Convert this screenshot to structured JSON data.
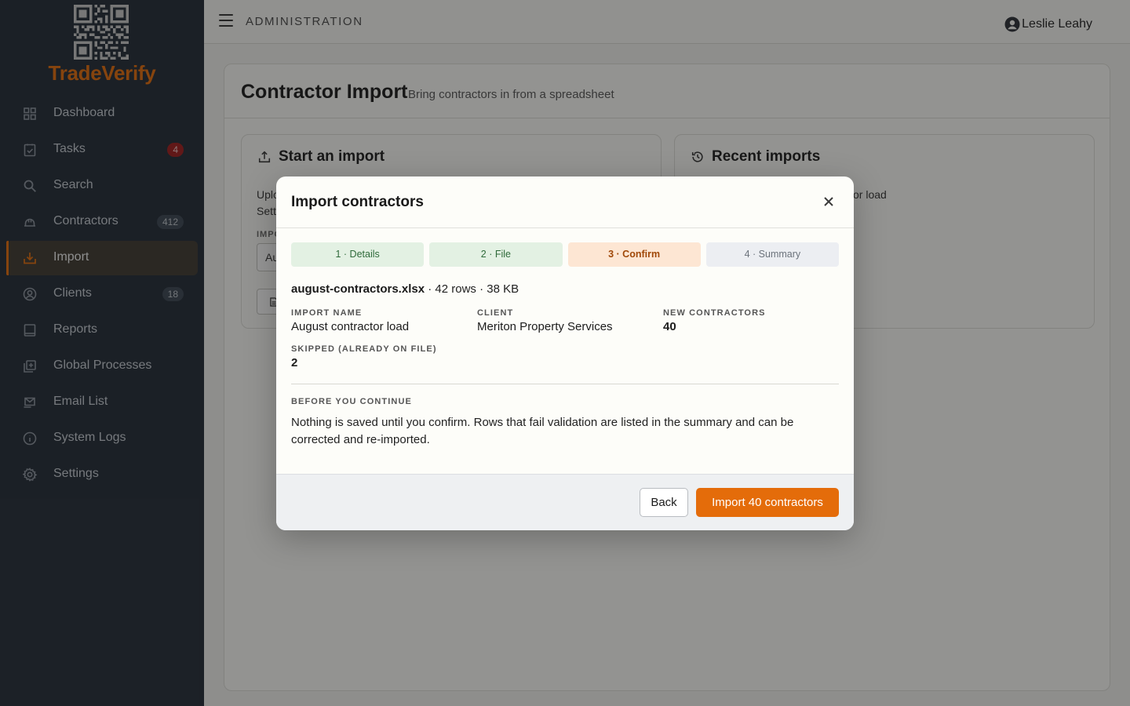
{
  "brand": {
    "name": "TradeVerify",
    "accent": "#e46c0a"
  },
  "topbar": {
    "section": "ADMINISTRATION",
    "user_name": "Leslie Leahy"
  },
  "sidebar": {
    "items": [
      {
        "label": "Dashboard",
        "icon": "grid-icon"
      },
      {
        "label": "Tasks",
        "icon": "clipboard-check-icon",
        "badge": "4"
      },
      {
        "label": "Search",
        "icon": "search-icon"
      },
      {
        "label": "Contractors",
        "icon": "hard-hat-icon",
        "badge": "412"
      },
      {
        "label": "Import",
        "icon": "download-tray-icon",
        "active": true
      },
      {
        "label": "Clients",
        "icon": "user-circle-icon",
        "badge": "18"
      },
      {
        "label": "Reports",
        "icon": "book-icon"
      },
      {
        "label": "Global Processes",
        "icon": "copy-plus-icon"
      },
      {
        "label": "Email List",
        "icon": "mail-icon"
      },
      {
        "label": "System Logs",
        "icon": "info-icon"
      },
      {
        "label": "Settings",
        "icon": "gear-icon"
      }
    ]
  },
  "page": {
    "title": "Contractor Import",
    "subtitle": "Bring contractors in from a spreadsheet",
    "start_panel": {
      "title": "Start an import",
      "text_line1": "Uplo",
      "text_line2": "Sett",
      "field_label": "IMPO",
      "field_value": "Au"
    },
    "recent_panel": {
      "title": "Recent imports",
      "text_fragment": "or load"
    }
  },
  "modal": {
    "title": "Import contractors",
    "steps": [
      {
        "label": "1 · Details",
        "state": "done"
      },
      {
        "label": "2 · File",
        "state": "done"
      },
      {
        "label": "3 · Confirm",
        "state": "current"
      },
      {
        "label": "4 · Summary",
        "state": "todo"
      }
    ],
    "file": {
      "name": "august-contractors.xlsx",
      "meta": " · 42 rows · 38 KB"
    },
    "fields": {
      "import_name": {
        "label": "IMPORT NAME",
        "value": "August contractor load"
      },
      "client": {
        "label": "CLIENT",
        "value": "Meriton Property Services"
      },
      "new_contractors": {
        "label": "NEW CONTRACTORS",
        "value": "40"
      },
      "skipped": {
        "label": "SKIPPED (ALREADY ON FILE)",
        "value": "2"
      }
    },
    "note": {
      "label": "BEFORE YOU CONTINUE",
      "text": "Nothing is saved until you confirm. Rows that fail validation are listed in the summary and can be corrected and re-imported."
    },
    "buttons": {
      "back": "Back",
      "confirm": "Import 40 contractors"
    }
  }
}
